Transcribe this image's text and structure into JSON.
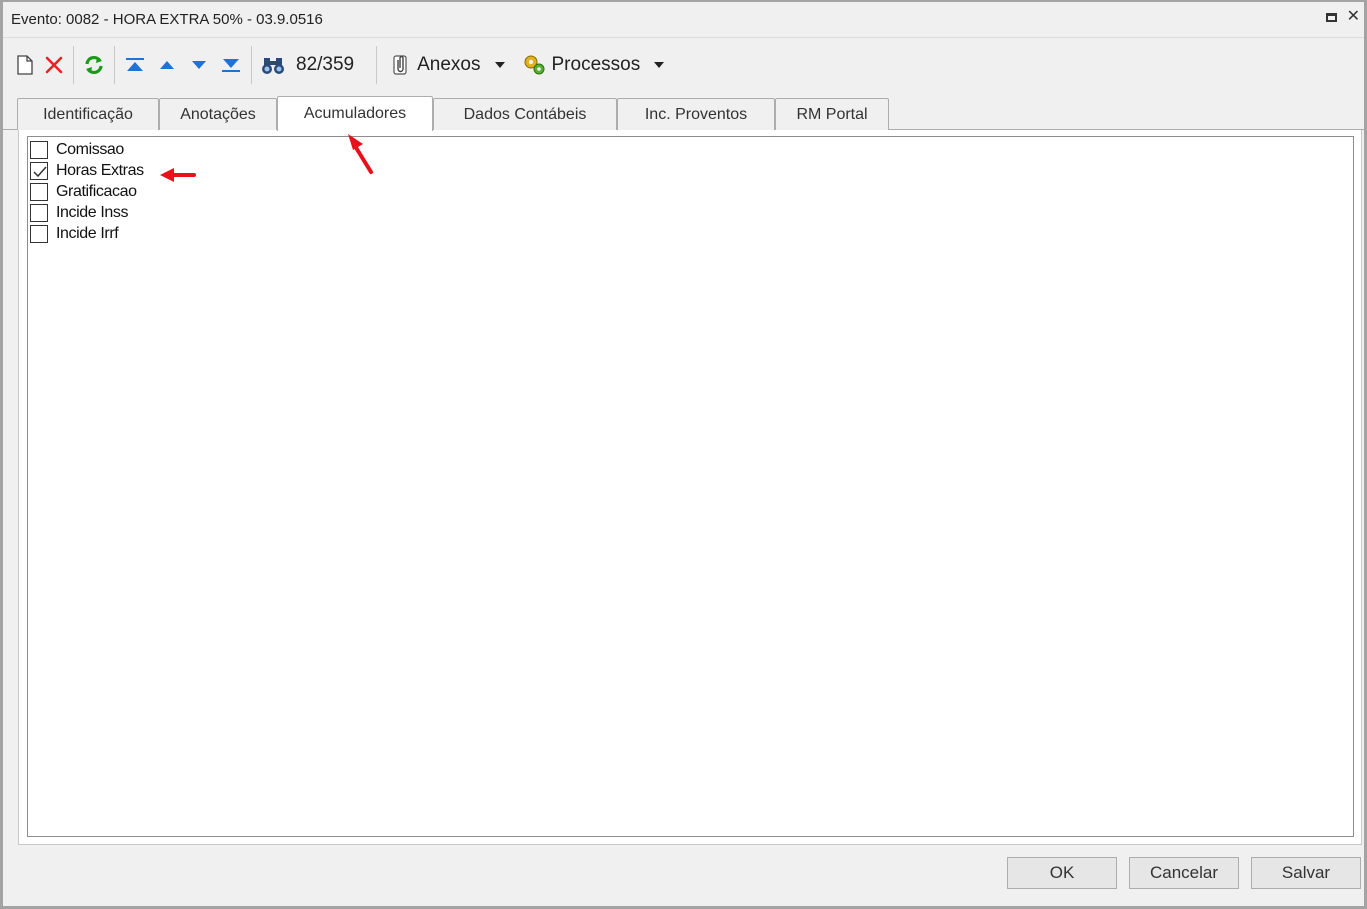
{
  "window": {
    "title": "Evento: 0082 - HORA EXTRA 50% - 03.9.0516"
  },
  "toolbar": {
    "record_counter": "82/359",
    "attachments_label": "Anexos",
    "processes_label": "Processos"
  },
  "tabs": [
    {
      "label": "Identificação",
      "active": false
    },
    {
      "label": "Anotações",
      "active": false
    },
    {
      "label": "Acumuladores",
      "active": true
    },
    {
      "label": "Dados Contábeis",
      "active": false
    },
    {
      "label": "Inc. Proventos",
      "active": false
    },
    {
      "label": "RM Portal",
      "active": false
    }
  ],
  "accumulators": [
    {
      "label": "Comissao",
      "checked": false
    },
    {
      "label": "Horas Extras",
      "checked": true
    },
    {
      "label": "Gratificacao",
      "checked": false
    },
    {
      "label": "Incide Inss",
      "checked": false
    },
    {
      "label": "Incide Irrf",
      "checked": false
    }
  ],
  "footer": {
    "ok_label": "OK",
    "cancel_label": "Cancelar",
    "save_label": "Salvar"
  },
  "colors": {
    "annotation_arrow": "#e8101a",
    "delete_icon": "#e82424",
    "refresh_icon": "#1a9a1a",
    "nav_icon": "#1e73d8"
  }
}
